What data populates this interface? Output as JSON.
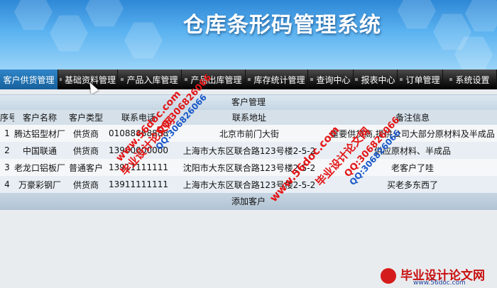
{
  "app": {
    "title": "仓库条形码管理系统"
  },
  "nav": [
    {
      "label": "客户供货管理",
      "active": true
    },
    {
      "label": "基础资料管理"
    },
    {
      "label": "产品入库管理"
    },
    {
      "label": "产品出库管理"
    },
    {
      "label": "库存统计管理"
    },
    {
      "label": "查询中心"
    },
    {
      "label": "报表中心"
    },
    {
      "label": "订单管理"
    },
    {
      "label": "系统设置"
    }
  ],
  "panel": {
    "title": "客户管理",
    "columns": [
      "序号",
      "客户名称",
      "客户类型",
      "联系电话",
      "联系地址",
      "备注信息"
    ],
    "rows": [
      {
        "no": "1",
        "name": "腾达铝型材厂",
        "type": "供货商",
        "phone": "01088888888",
        "address": "北京市前门大街",
        "note": "重要供货商,提供公司大部分原材料及半成品"
      },
      {
        "no": "2",
        "name": "中国联通",
        "type": "供货商",
        "phone": "13900000000",
        "address": "上海市大东区联合路123号楼2-5-2",
        "note": "供应原材料、半成品"
      },
      {
        "no": "3",
        "name": "老龙口铝板厂",
        "type": "普通客户",
        "phone": "13911111111",
        "address": "沈阳市大东区联合路123号楼2-5-2",
        "note": "老客户了哇"
      },
      {
        "no": "4",
        "name": "万豪彩钢厂",
        "type": "供货商",
        "phone": "13911111111",
        "address": "上海市大东区联合路123号楼2-5-2",
        "note": "买老多东西了"
      }
    ],
    "add_label": "添加客户"
  },
  "watermarks": {
    "site": "www.56doc.com",
    "qq": "QQ:306826066",
    "brand": "毕业设计论文网"
  },
  "footer": {
    "brand": "毕业设计论文网",
    "url": "www.56doc.com"
  }
}
